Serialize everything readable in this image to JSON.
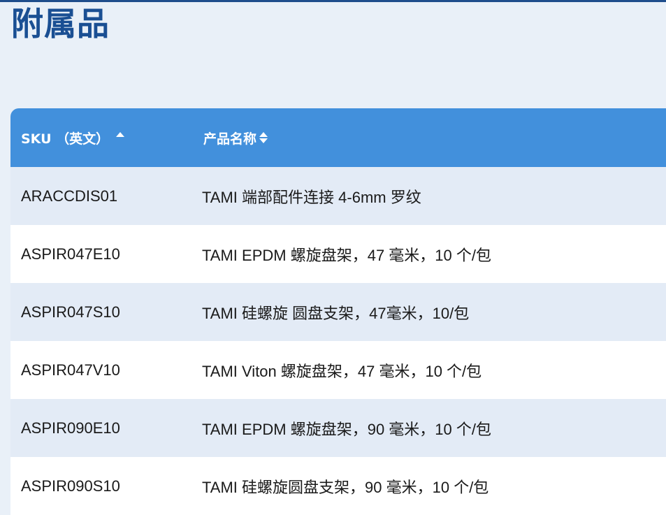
{
  "page": {
    "title": "附属品"
  },
  "table": {
    "headers": {
      "sku": "SKU （英文）",
      "name": "产品名称"
    },
    "rows": [
      {
        "sku": "ARACCDIS01",
        "name": "TAMI 端部配件连接 4-6mm 罗纹"
      },
      {
        "sku": "ASPIR047E10",
        "name": "TAMI EPDM 螺旋盘架，47 毫米，10 个/包"
      },
      {
        "sku": "ASPIR047S10",
        "name": "TAMI 硅螺旋 圆盘支架，47毫米，10/包"
      },
      {
        "sku": "ASPIR047V10",
        "name": "TAMI Viton 螺旋盘架，47 毫米，10 个/包"
      },
      {
        "sku": "ASPIR090E10",
        "name": "TAMI EPDM 螺旋盘架，90 毫米，10 个/包"
      },
      {
        "sku": "ASPIR090S10",
        "name": "TAMI 硅螺旋圆盘支架，90 毫米，10 个/包"
      }
    ]
  },
  "colors": {
    "title": "#1a4f93",
    "header_bg": "#4290dc",
    "row_odd": "#e3ebf6",
    "row_even": "#ffffff",
    "page_bg": "#e9f0f8"
  },
  "icons": {
    "sku_sort": "sort-ascending-icon",
    "name_sort": "sort-both-icon"
  }
}
